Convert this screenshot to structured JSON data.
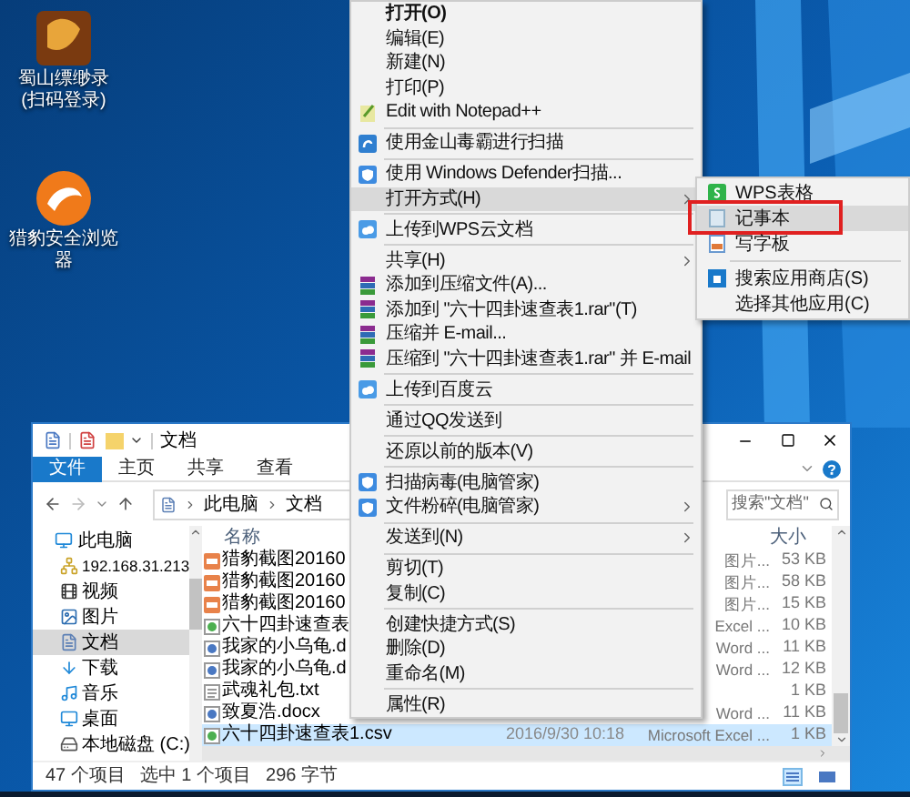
{
  "desktop_icons": [
    {
      "label": "蜀山缥缈录(扫码登录)"
    },
    {
      "label": "猎豹安全浏览器"
    }
  ],
  "explorer": {
    "title": "文档",
    "ribbon_tabs": [
      {
        "label": "文件",
        "selected": true
      },
      {
        "label": "主页",
        "selected": false
      },
      {
        "label": "共享",
        "selected": false
      },
      {
        "label": "查看",
        "selected": false
      }
    ],
    "breadcrumb": [
      "此电脑",
      "文档"
    ],
    "search": {
      "placeholder": "搜索\"文档\""
    },
    "nav": [
      {
        "label": "此电脑",
        "selected": false,
        "children": [
          {
            "label": "192.168.31.213",
            "selected": false
          },
          {
            "label": "视频",
            "selected": false
          },
          {
            "label": "图片",
            "selected": false
          },
          {
            "label": "文档",
            "selected": true
          },
          {
            "label": "下载",
            "selected": false
          },
          {
            "label": "音乐",
            "selected": false
          },
          {
            "label": "桌面",
            "selected": false
          },
          {
            "label": "本地磁盘 (C:)",
            "selected": false
          }
        ]
      }
    ],
    "columns": {
      "name": "名称",
      "size": "大小"
    },
    "files": [
      {
        "kind": "image",
        "name": "猎豹截图20160",
        "type": "图片...",
        "size": "53 KB",
        "selected": false
      },
      {
        "kind": "image",
        "name": "猎豹截图20160",
        "type": "图片...",
        "size": "58 KB",
        "selected": false
      },
      {
        "kind": "image",
        "name": "猎豹截图20160",
        "type": "图片...",
        "size": "15 KB",
        "selected": false
      },
      {
        "kind": "excel",
        "name": "六十四卦速查表",
        "type": "Excel ...",
        "size": "10 KB",
        "selected": false
      },
      {
        "kind": "word",
        "name": "我家的小乌龟.d",
        "type": "Word ...",
        "size": "11 KB",
        "selected": false
      },
      {
        "kind": "word",
        "name": "我家的小乌龟.d",
        "type": "Word ...",
        "size": "12 KB",
        "selected": false
      },
      {
        "kind": "text",
        "name": "武魂礼包.txt",
        "size": "1 KB",
        "selected": false
      },
      {
        "kind": "word",
        "name": "致夏浩.docx",
        "type": "Word ...",
        "size": "11 KB",
        "selected": false
      },
      {
        "kind": "excel",
        "name": "六十四卦速查表1.csv",
        "date": "2016/9/30 10:18",
        "type": "Microsoft Excel ...",
        "size": "1 KB",
        "selected": true
      }
    ],
    "status": [
      "47 个项目",
      "选中 1 个项目",
      "296 字节"
    ]
  },
  "context_menu": {
    "items": [
      {
        "kind": "item",
        "label": "打开(O)",
        "default": true,
        "submenu": false,
        "highlighted": false
      },
      {
        "kind": "item",
        "label": "编辑(E)",
        "default": false,
        "submenu": false,
        "highlighted": false
      },
      {
        "kind": "item",
        "label": "新建(N)",
        "default": false,
        "submenu": false,
        "highlighted": false
      },
      {
        "kind": "item",
        "label": "打印(P)",
        "default": false,
        "submenu": false,
        "highlighted": false
      },
      {
        "kind": "item",
        "label": "Edit with Notepad++",
        "default": false,
        "submenu": false,
        "highlighted": false
      },
      {
        "kind": "separator"
      },
      {
        "kind": "item",
        "label": "使用金山毒霸进行扫描",
        "default": false,
        "submenu": false,
        "highlighted": false
      },
      {
        "kind": "separator"
      },
      {
        "kind": "item",
        "label": "使用 Windows Defender扫描...",
        "default": false,
        "submenu": false,
        "highlighted": false
      },
      {
        "kind": "item",
        "label": "打开方式(H)",
        "default": false,
        "submenu": true,
        "highlighted": true
      },
      {
        "kind": "separator"
      },
      {
        "kind": "item",
        "label": "上传到WPS云文档",
        "default": false,
        "submenu": false,
        "highlighted": false
      },
      {
        "kind": "separator"
      },
      {
        "kind": "item",
        "label": "共享(H)",
        "default": false,
        "submenu": true,
        "highlighted": false
      },
      {
        "kind": "item",
        "label": "添加到压缩文件(A)...",
        "default": false,
        "submenu": false,
        "highlighted": false
      },
      {
        "kind": "item",
        "label": "添加到 \"六十四卦速查表1.rar\"(T)",
        "default": false,
        "submenu": false,
        "highlighted": false
      },
      {
        "kind": "item",
        "label": "压缩并 E-mail...",
        "default": false,
        "submenu": false,
        "highlighted": false
      },
      {
        "kind": "item",
        "label": "压缩到 \"六十四卦速查表1.rar\" 并 E-mail",
        "default": false,
        "submenu": false,
        "highlighted": false
      },
      {
        "kind": "separator"
      },
      {
        "kind": "item",
        "label": "上传到百度云",
        "default": false,
        "submenu": false,
        "highlighted": false
      },
      {
        "kind": "separator"
      },
      {
        "kind": "item",
        "label": "通过QQ发送到",
        "default": false,
        "submenu": false,
        "highlighted": false
      },
      {
        "kind": "separator"
      },
      {
        "kind": "item",
        "label": "还原以前的版本(V)",
        "default": false,
        "submenu": false,
        "highlighted": false
      },
      {
        "kind": "separator"
      },
      {
        "kind": "item",
        "label": "扫描病毒(电脑管家)",
        "default": false,
        "submenu": false,
        "highlighted": false
      },
      {
        "kind": "item",
        "label": "文件粉碎(电脑管家)",
        "default": false,
        "submenu": true,
        "highlighted": false
      },
      {
        "kind": "separator"
      },
      {
        "kind": "item",
        "label": "发送到(N)",
        "default": false,
        "submenu": true,
        "highlighted": false
      },
      {
        "kind": "separator"
      },
      {
        "kind": "item",
        "label": "剪切(T)",
        "default": false,
        "submenu": false,
        "highlighted": false
      },
      {
        "kind": "item",
        "label": "复制(C)",
        "default": false,
        "submenu": false,
        "highlighted": false
      },
      {
        "kind": "separator"
      },
      {
        "kind": "item",
        "label": "创建快捷方式(S)",
        "default": false,
        "submenu": false,
        "highlighted": false
      },
      {
        "kind": "item",
        "label": "删除(D)",
        "default": false,
        "submenu": false,
        "highlighted": false
      },
      {
        "kind": "item",
        "label": "重命名(M)",
        "default": false,
        "submenu": false,
        "highlighted": false
      },
      {
        "kind": "separator"
      },
      {
        "kind": "item",
        "label": "属性(R)",
        "default": false,
        "submenu": false,
        "highlighted": false
      }
    ]
  },
  "open_with_menu": {
    "items": [
      {
        "kind": "item",
        "label": "WPS表格",
        "selected": false,
        "outlined": false
      },
      {
        "kind": "item",
        "label": "记事本",
        "selected": true,
        "outlined": true
      },
      {
        "kind": "item",
        "label": "写字板",
        "selected": false,
        "outlined": false
      },
      {
        "kind": "separator"
      },
      {
        "kind": "item",
        "label": "搜索应用商店(S)",
        "selected": false,
        "outlined": false
      },
      {
        "kind": "item",
        "label": "选择其他应用(C)",
        "selected": false,
        "outlined": false
      }
    ]
  }
}
